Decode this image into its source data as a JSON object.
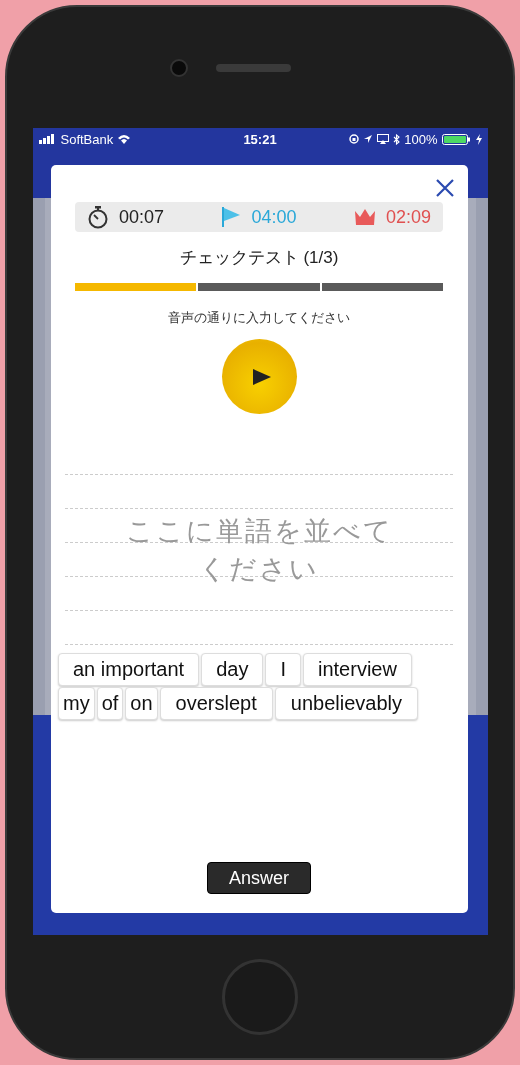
{
  "status_bar": {
    "carrier": "SoftBank",
    "time": "15:21",
    "battery": "100%"
  },
  "timer": {
    "elapsed": "00:07",
    "target": "04:00",
    "best": "02:09"
  },
  "title": "チェックテスト (1/3)",
  "progress": [
    {
      "filled": true
    },
    {
      "filled": false
    },
    {
      "filled": false
    }
  ],
  "instruction": "音声の通りに入力してください",
  "answer_area": {
    "placeholder": "ここに単語を並べてください"
  },
  "word_rows": [
    [
      "an important",
      "day",
      "I",
      "interview"
    ],
    [
      "my",
      "of",
      "on",
      "overslept",
      "unbelievably"
    ]
  ],
  "answer_button": "Answer"
}
